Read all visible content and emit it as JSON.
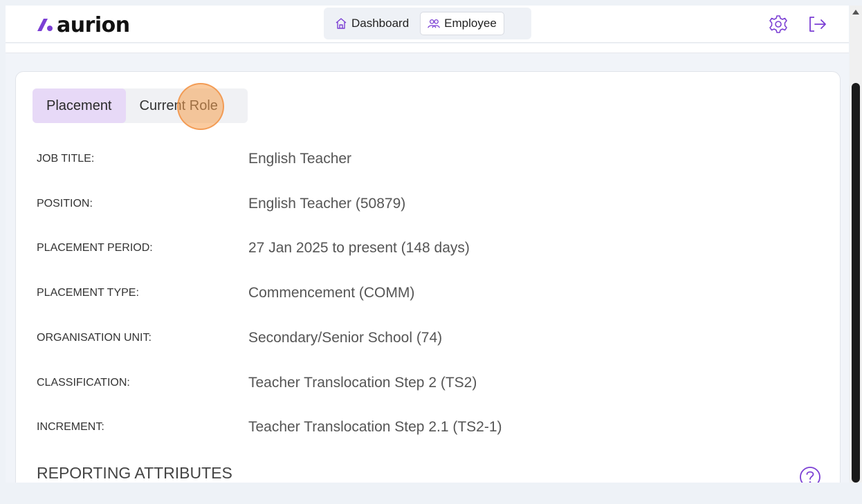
{
  "app": {
    "logo_text": "aurion"
  },
  "nav": {
    "dashboard_label": "Dashboard",
    "employee_label": "Employee"
  },
  "icons": {
    "home": "home-icon",
    "people": "people-icon",
    "settings": "gear-icon",
    "logout": "logout-icon",
    "help": "help-icon"
  },
  "tabs": [
    {
      "label": "Placement",
      "active": true
    },
    {
      "label": "Current Role",
      "active": false
    }
  ],
  "fields": [
    {
      "label": "JOB TITLE:",
      "value": "English Teacher"
    },
    {
      "label": "POSITION:",
      "value": "English Teacher (50879)"
    },
    {
      "label": "PLACEMENT PERIOD:",
      "value": "27 Jan 2025 to present (148 days)"
    },
    {
      "label": "PLACEMENT TYPE:",
      "value": "Commencement (COMM)"
    },
    {
      "label": "ORGANISATION UNIT:",
      "value": "Secondary/Senior School (74)"
    },
    {
      "label": "CLASSIFICATION:",
      "value": "Teacher Translocation Step 2 (TS2)"
    },
    {
      "label": "INCREMENT:",
      "value": "Teacher Translocation Step 2.1 (TS2-1)"
    }
  ],
  "sections": {
    "reporting_attributes": "REPORTING ATTRIBUTES"
  },
  "colors": {
    "accent": "#7b3fd4",
    "tab_active_bg": "#e7d9f7",
    "click_marker": "#f5a050"
  }
}
